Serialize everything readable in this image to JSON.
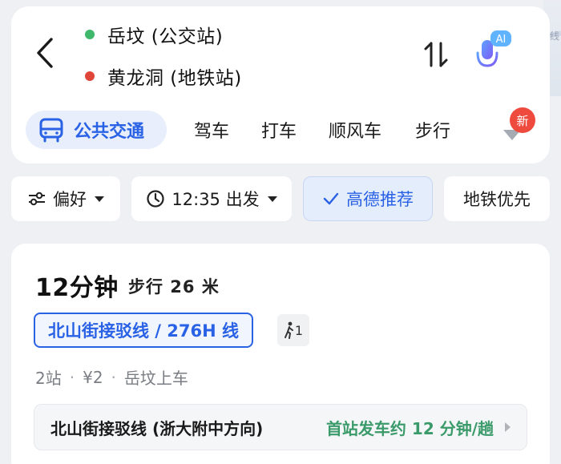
{
  "colors": {
    "origin_dot": "#3fb86b",
    "dest_dot": "#e0453a",
    "accent": "#2a62e6",
    "new_badge": "#ee4a3e",
    "frequency_text": "#3b9a6a"
  },
  "header": {
    "back_icon": "chevron-left-icon",
    "origin": "岳坟 (公交站)",
    "destination": "黄龙洞 (地铁站)",
    "swap_icon": "swap-vertical-icon",
    "ai_icon": "ai-microphone-icon",
    "ai_label": "AI"
  },
  "map_edge": {
    "label": "线"
  },
  "modes": {
    "active": {
      "label": "公共交通",
      "icon": "bus-icon"
    },
    "tabs": [
      "驾车",
      "打车",
      "顺风车",
      "步行"
    ],
    "new_badge": "新"
  },
  "filters": {
    "preference": "偏好",
    "depart": "12:35 出发",
    "recommended": "高德推荐",
    "subway_first": "地铁优先"
  },
  "result": {
    "duration": "12分钟",
    "walk": "步行 26 米",
    "line": "北山街接驳线 / 276H 线",
    "walk_segments": "1",
    "stops": "2站",
    "price": "¥2",
    "board": "岳坟上车",
    "direction": "北山街接驳线 (浙大附中方向)",
    "frequency": "首站发车约 12 分钟/趟"
  }
}
